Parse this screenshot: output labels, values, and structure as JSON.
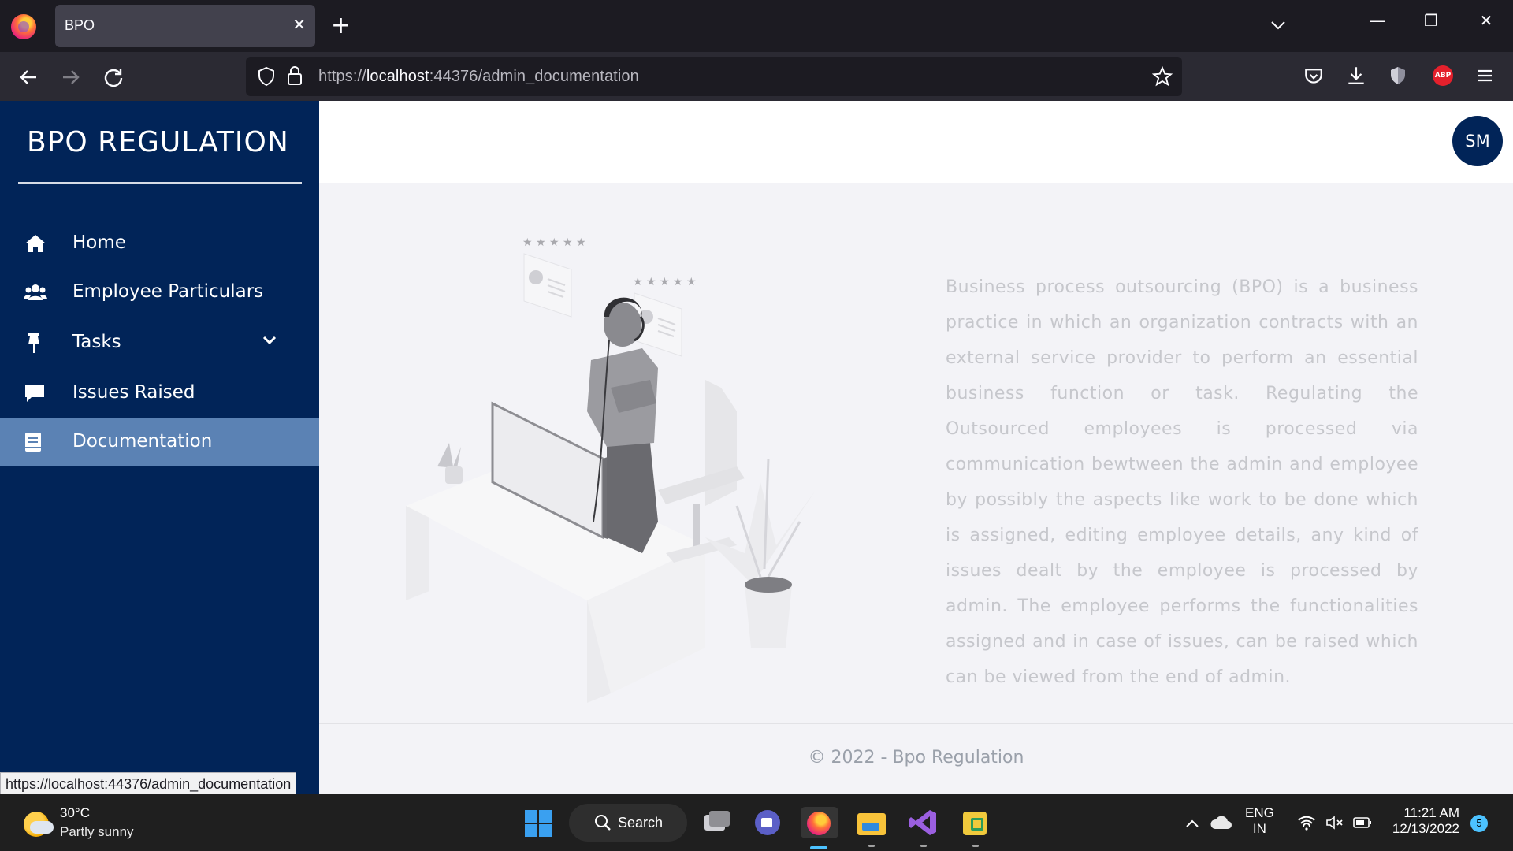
{
  "browser": {
    "tab_title": "BPO",
    "url_prefix": "https://",
    "url_host": "localhost",
    "url_rest": ":44376/admin_documentation",
    "status_url": "https://localhost:44376/admin_documentation",
    "abp_label": "ABP"
  },
  "sidebar": {
    "brand": "BPO REGULATION",
    "items": [
      {
        "label": "Home",
        "icon": "home-icon"
      },
      {
        "label": "Employee Particulars",
        "icon": "users-icon"
      },
      {
        "label": "Tasks",
        "icon": "pin-icon"
      },
      {
        "label": "Issues Raised",
        "icon": "comment-icon"
      },
      {
        "label": "Documentation",
        "icon": "book-icon",
        "active": true
      }
    ]
  },
  "header": {
    "avatar_initials": "SM"
  },
  "main": {
    "description": "Business process outsourcing (BPO) is a business practice in which an organization contracts with an external service provider to perform an essential business function or task. Regulating the Outsourced employees is processed via communication bewtween the admin and employee by possibly the aspects like work to be done which is assigned, editing employee details, any kind of issues dealt by the employee is processed by admin. The employee performs the functionalities assigned and in case of issues, can be raised which can be viewed from the end of admin."
  },
  "footer": {
    "text": "© 2022 - Bpo Regulation"
  },
  "taskbar": {
    "temperature": "30°C",
    "condition": "Partly sunny",
    "search_label": "Search",
    "lang_top": "ENG",
    "lang_bottom": "IN",
    "time": "11:21 AM",
    "date": "12/13/2022",
    "notification_count": "5"
  },
  "colors": {
    "sidebar_bg": "#012458",
    "active_item": "#5b82b4",
    "main_bg": "#f3f3f7",
    "text_muted": "#c6c7cc"
  }
}
